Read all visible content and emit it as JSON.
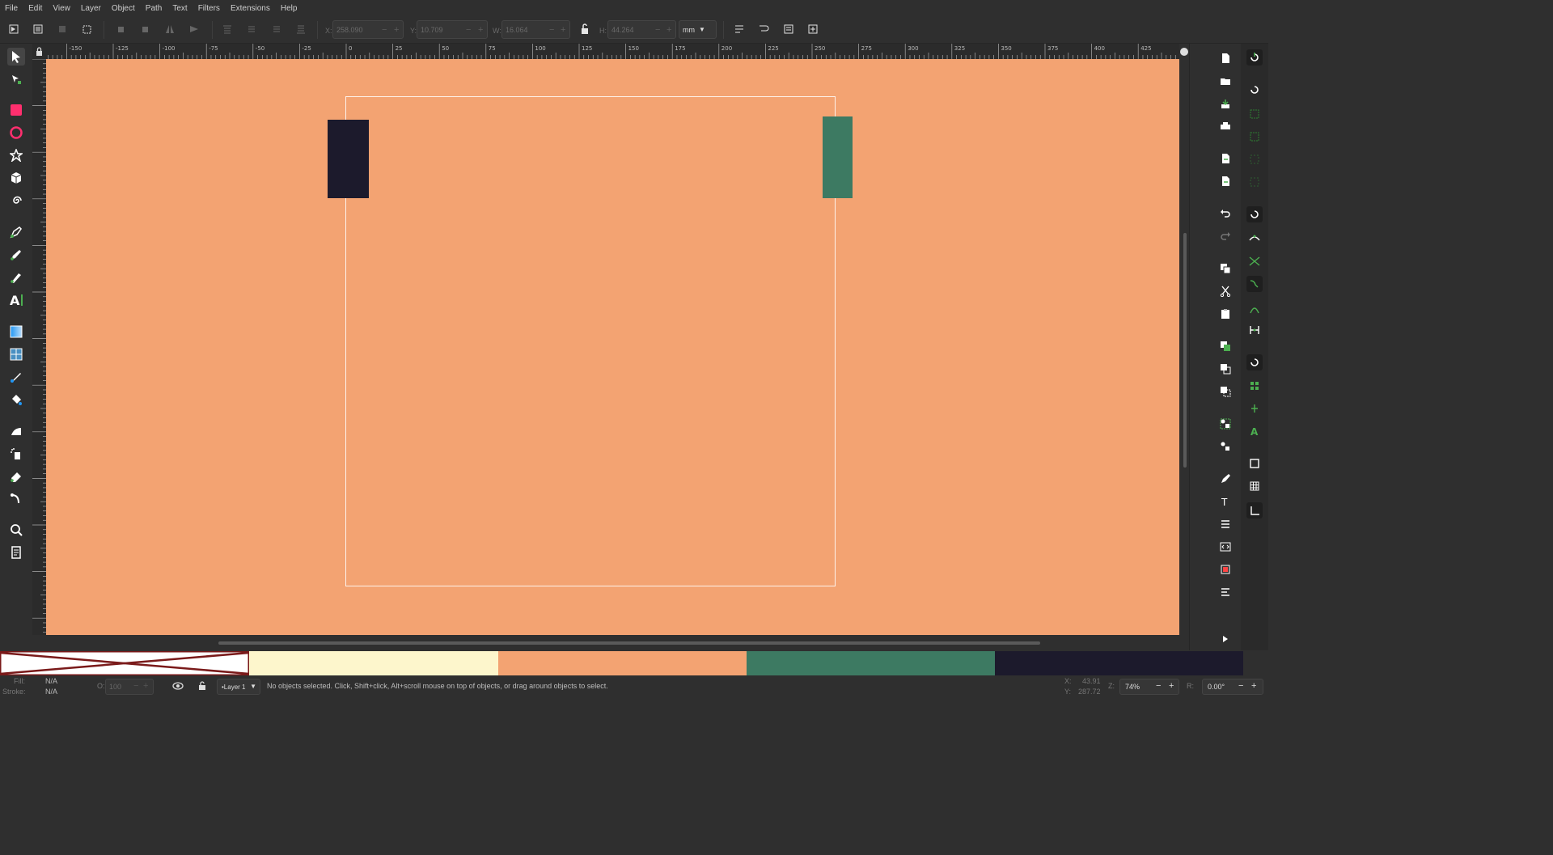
{
  "menu": [
    "File",
    "Edit",
    "View",
    "Layer",
    "Object",
    "Path",
    "Text",
    "Filters",
    "Extensions",
    "Help"
  ],
  "toolbar": {
    "x_label": "X:",
    "x_value": "258.090",
    "y_label": "Y:",
    "y_value": "10.709",
    "w_label": "W:",
    "w_value": "16.064",
    "h_label": "H:",
    "h_value": "44.264",
    "unit": "mm"
  },
  "ruler_h_labels": [
    "-150",
    "-125",
    "-100",
    "-75",
    "-50",
    "-25",
    "0",
    "25",
    "50",
    "75",
    "100",
    "125",
    "150",
    "175",
    "200",
    "225",
    "250",
    "275",
    "300",
    "325",
    "350",
    "375",
    "400",
    "425"
  ],
  "canvas": {
    "background": "#f3a372"
  },
  "objects": [
    {
      "name": "dark-rectangle",
      "color": "#1c1a2c"
    },
    {
      "name": "green-rectangle",
      "color": "#3d7a62"
    }
  ],
  "palette": {
    "swatches": [
      "none",
      "#fdf6cc",
      "#f3a372",
      "#3d7a62",
      "#1c1a2c"
    ]
  },
  "status": {
    "fill_label": "Fill:",
    "fill_value": "N/A",
    "stroke_label": "Stroke:",
    "stroke_value": "N/A",
    "opacity_label": "O:",
    "opacity_value": "100",
    "layer": "•Layer 1",
    "message": "No objects selected. Click, Shift+click, Alt+scroll mouse on top of objects, or drag around objects to select.",
    "cursor_x_label": "X:",
    "cursor_x": "43.91",
    "cursor_y_label": "Y:",
    "cursor_y": "287.72",
    "zoom_label": "Z:",
    "zoom": "74%",
    "rotation_label": "R:",
    "rotation": "0.00°"
  }
}
